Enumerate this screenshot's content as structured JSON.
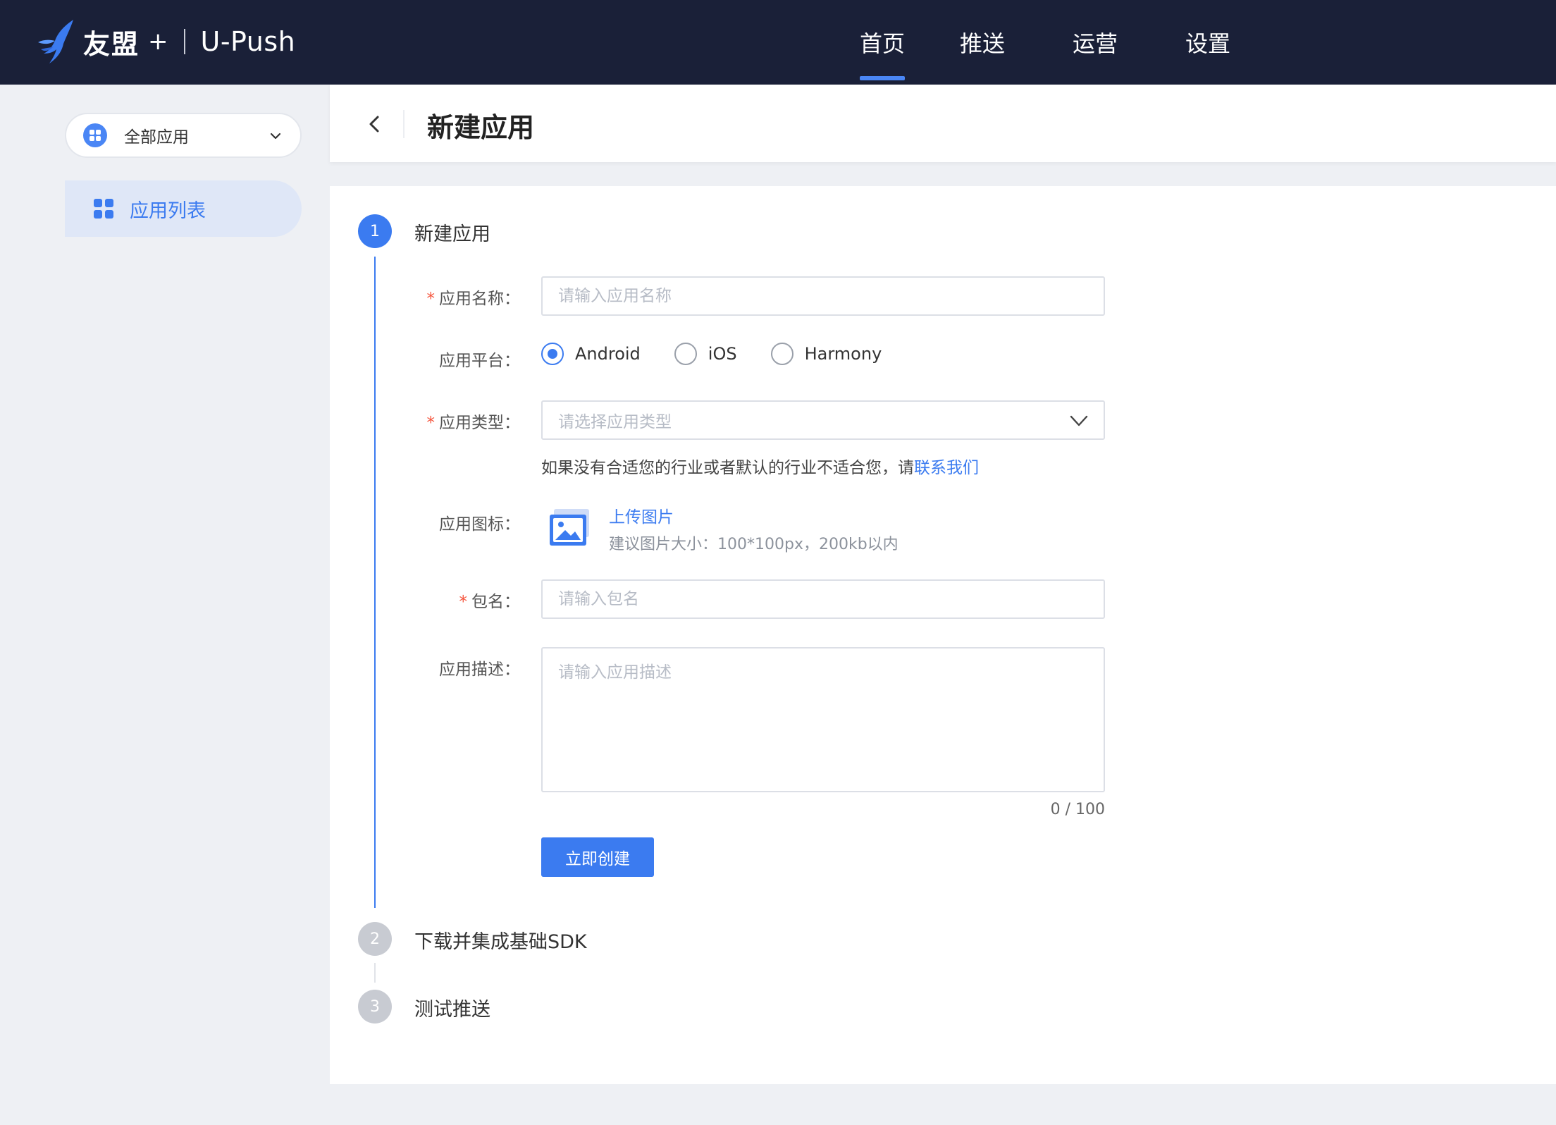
{
  "brand": {
    "name": "友盟",
    "plus": "+",
    "product": "U-Push"
  },
  "topnav": {
    "items": [
      {
        "label": "首页",
        "active": true
      },
      {
        "label": "推送",
        "active": false
      },
      {
        "label": "运营",
        "active": false
      },
      {
        "label": "设置",
        "active": false
      }
    ]
  },
  "sidebar": {
    "app_selector": {
      "label": "全部应用"
    },
    "items": [
      {
        "label": "应用列表",
        "active": true
      }
    ]
  },
  "header": {
    "title": "新建应用"
  },
  "steps": [
    {
      "number": "1",
      "title": "新建应用",
      "status": "active"
    },
    {
      "number": "2",
      "title": "下载并集成基础SDK",
      "status": "pending"
    },
    {
      "number": "3",
      "title": "测试推送",
      "status": "pending"
    }
  ],
  "form": {
    "required_mark": "*",
    "app_name": {
      "label": "应用名称：",
      "placeholder": "请输入应用名称",
      "value": ""
    },
    "platform": {
      "label": "应用平台：",
      "options": [
        "Android",
        "iOS",
        "Harmony"
      ],
      "selected": "Android"
    },
    "app_type": {
      "label": "应用类型：",
      "placeholder": "请选择应用类型"
    },
    "type_hint": {
      "text": "如果没有合适您的行业或者默认的行业不适合您，请",
      "link": "联系我们"
    },
    "app_icon": {
      "label": "应用图标：",
      "upload_link": "上传图片",
      "upload_hint": "建议图片大小：100*100px，200kb以内"
    },
    "package_name": {
      "label": "包名：",
      "placeholder": "请输入包名",
      "value": ""
    },
    "description": {
      "label": "应用描述：",
      "placeholder": "请输入应用描述",
      "counter": "0 / 100"
    },
    "submit_label": "立即创建"
  },
  "colors": {
    "topbar_bg": "#1a2038",
    "accent": "#3b7bf0",
    "required": "#f5553d",
    "page_bg": "#eef0f4"
  }
}
